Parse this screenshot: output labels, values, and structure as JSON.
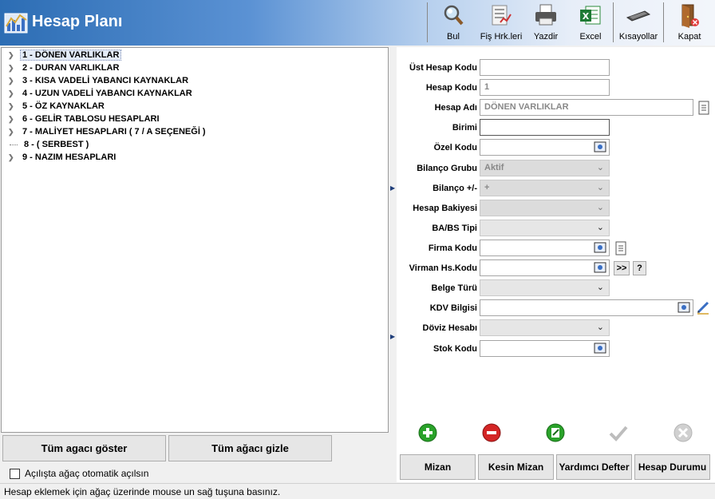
{
  "window": {
    "title": "Hesap Planı"
  },
  "toolbar": [
    {
      "label": "Bul",
      "icon": "search-icon"
    },
    {
      "label": "Fiş Hrk.leri",
      "icon": "document-list-icon"
    },
    {
      "label": "Yazdir",
      "icon": "printer-icon"
    },
    {
      "label": "Excel",
      "icon": "excel-icon"
    },
    {
      "label": "Kısayollar",
      "icon": "keyboard-icon"
    },
    {
      "label": "Kapat",
      "icon": "exit-door-icon"
    }
  ],
  "tree": [
    {
      "label": "1 - DÖNEN VARLIKLAR",
      "expandable": true,
      "selected": true
    },
    {
      "label": "2 - DURAN VARLIKLAR",
      "expandable": true
    },
    {
      "label": "3 - KISA VADELİ YABANCI KAYNAKLAR",
      "expandable": true
    },
    {
      "label": "4 - UZUN VADELİ YABANCI KAYNAKLAR",
      "expandable": true
    },
    {
      "label": "5 - ÖZ KAYNAKLAR",
      "expandable": true
    },
    {
      "label": "6 - GELİR TABLOSU HESAPLARI",
      "expandable": true
    },
    {
      "label": "7 - MALİYET HESAPLARI ( 7 / A  SEÇENEĞİ )",
      "expandable": true
    },
    {
      "label": "8 - ( SERBEST )",
      "expandable": false
    },
    {
      "label": "9 - NAZIM HESAPLARI",
      "expandable": true
    }
  ],
  "tree_buttons": {
    "show_all": "Tüm agacı göster",
    "hide_all": "Tüm ağacı gizle"
  },
  "auto_expand": {
    "label": "Açılışta ağaç otomatik açılsın",
    "checked": false
  },
  "form": {
    "ust_hesap_kodu": {
      "label": "Üst Hesap Kodu",
      "value": ""
    },
    "hesap_kodu": {
      "label": "Hesap Kodu",
      "value": "1"
    },
    "hesap_adi": {
      "label": "Hesap Adı",
      "value": "DÖNEN VARLIKLAR"
    },
    "birimi": {
      "label": "Birimi",
      "value": ""
    },
    "ozel_kodu": {
      "label": "Özel Kodu",
      "value": ""
    },
    "bilanco_grubu": {
      "label": "Bilanço Grubu",
      "value": "Aktif"
    },
    "bilanco_isaret": {
      "label": "Bilanço +/-",
      "value": "+"
    },
    "hesap_bakiyesi": {
      "label": "Hesap Bakiyesi",
      "value": ""
    },
    "ba_bs_tipi": {
      "label": "BA/BS Tipi",
      "value": ""
    },
    "firma_kodu": {
      "label": "Firma Kodu",
      "value": ""
    },
    "virman_hs_kodu": {
      "label": "Virman Hs.Kodu",
      "value": "",
      "btn_next": ">>",
      "btn_help": "?"
    },
    "belge_turu": {
      "label": "Belge Türü",
      "value": ""
    },
    "kdv_bilgisi": {
      "label": "KDV Bilgisi",
      "value": ""
    },
    "doviz_hesabi": {
      "label": "Döviz Hesabı",
      "value": ""
    },
    "stok_kodu": {
      "label": "Stok Kodu",
      "value": ""
    }
  },
  "actions": [
    "add-icon",
    "remove-icon",
    "edit-icon",
    "confirm-icon",
    "cancel-icon"
  ],
  "bottom_buttons": {
    "mizan": "Mizan",
    "kesin_mizan": "Kesin Mizan",
    "yardimci_defter": "Yardımcı Defter",
    "hesap_durumu": "Hesap Durumu"
  },
  "status": {
    "text": "Hesap eklemek için ağaç üzerinde mouse un sağ tuşuna basınız."
  },
  "colors": {
    "header_start": "#2c6db4",
    "selection": "#e3ebf7",
    "add": "#2aa22a",
    "remove": "#d42525"
  }
}
